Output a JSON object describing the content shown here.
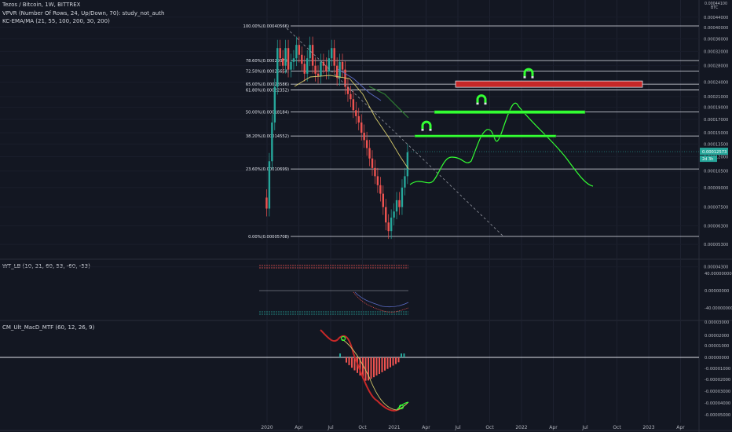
{
  "header": {
    "title": "Tezos / Bitcoin, 1W, BITTREX",
    "indicator_1": "VPVR (Number Of Rows, 24, Up/Down, 70): study_not_auth",
    "indicator_2": "KC-EMA/MA (21, 55, 100, 200, 30, 200)"
  },
  "axis_header": {
    "line1": "0.00044100",
    "line2": "BTC"
  },
  "panes": {
    "wt_label": "WT_LB (10, 21, 60, 53, -60, -53)",
    "macd_label": "CM_Ult_MacD_MTF (60, 12, 26, 9)"
  },
  "colors": {
    "background": "#131722",
    "up": "#26a69a",
    "down": "#ef5350",
    "forecast": "#33ff33",
    "target_box": "#c62828",
    "price_label": "#26a69a"
  },
  "chart_data": {
    "type": "line",
    "x_ticks": [
      "2020",
      "Apr",
      "Jul",
      "Oct",
      "2021",
      "Apr",
      "Jul",
      "Oct",
      "2022",
      "Apr",
      "Jul",
      "Oct",
      "2023",
      "Apr"
    ],
    "y_ticks": [
      "0.00044000",
      "0.00040000",
      "0.00036000",
      "0.00032000",
      "0.00028000",
      "0.00024000",
      "0.00021000",
      "0.00019000",
      "0.00017000",
      "0.00015000",
      "0.00013500",
      "0.00012000",
      "0.00010500",
      "0.00009000",
      "0.00007500",
      "0.00006300",
      "0.00005300",
      "0.00004300"
    ],
    "current_price": {
      "value": "0.00012573",
      "countdown": "2d 3h"
    },
    "fib_levels": [
      {
        "label": "100.00%(0.00040566)",
        "value": 0.00040566
      },
      {
        "label": "78.60%(0.00029374)",
        "value": 0.00029374
      },
      {
        "label": "72.50%(0.00026664)",
        "value": 0.00026664
      },
      {
        "label": "65.00%(0.00023586)",
        "value": 0.00023586
      },
      {
        "label": "61.80%(0.00022352)",
        "value": 0.00022352
      },
      {
        "label": "50.00%(0.00018184)",
        "value": 0.00018184
      },
      {
        "label": "38.20%(0.00014552)",
        "value": 0.00014552
      },
      {
        "label": "23.60%(0.00010699)",
        "value": 0.00010699
      },
      {
        "label": "0.00%(0.00005708)",
        "value": 5.708e-05
      }
    ],
    "wt_y_ticks": [
      "40.00000000",
      "0.00000000",
      "-40.00000000"
    ],
    "macd_y_ticks": [
      "0.00003000",
      "0.00002000",
      "0.00001000",
      "0.00000000",
      "-0.00001000",
      "-0.00002000",
      "-0.00003000",
      "-0.00004000",
      "-0.00005000"
    ]
  }
}
